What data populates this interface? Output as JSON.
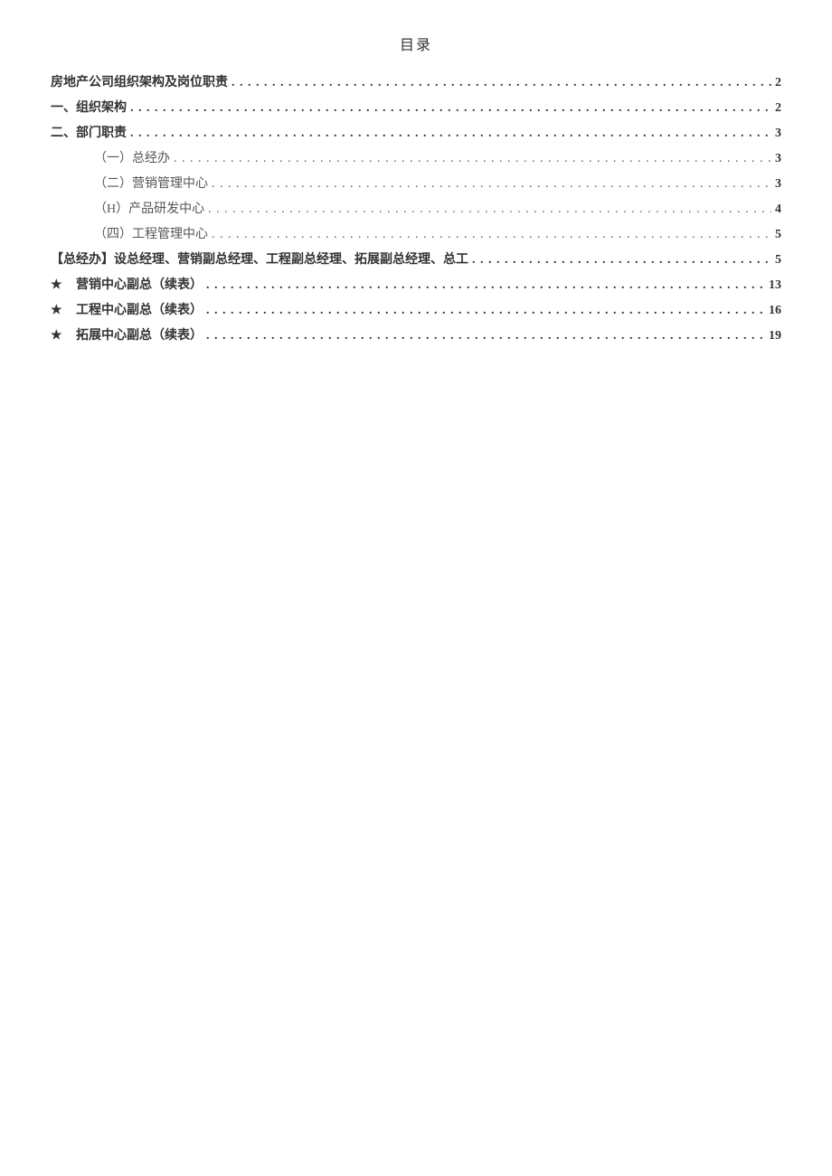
{
  "title": "目录",
  "leader": ". . . . . . . . . . . . . . . . . . . . . . . . . . . . . . . . . . . . . . . . . . . . . . . . . . . . . . . . . . . . . . . . . . . . . . . . . . . . . . . . . . . . . . . . . . . . . . . . . . . . . . . . . . . . . . . . . . . . . . . . . . . . . . . . . . . . . . . . . . . . . . . . . . . . . . . . . . . . . . . . . . . . . . . . . . . . . . . . . . . . . . . . . . . . . . . . . . . . . . . . . . . . . . . . . . . . . . . . . . . . . . . . . . . . . . . . . . . . . . . . . . . . . . . . . . . . . . . . . . . . . . . . . . . . . . . . . . . . . . . . . . . . . . . . . . . . . . . . . . . . . . . . . . . . . . . . . . . . . . . . . . . . . . . . . . . . . . . . . . . . . . . . . . . . . . . . . . . . . . . . . . . . . . . . . . . . . . . . . . . . . . . .",
  "entries": [
    {
      "level": 1,
      "star": false,
      "label": "房地产公司组织架构及岗位职责",
      "page": "2"
    },
    {
      "level": 1,
      "star": false,
      "label": "一、组织架构",
      "page": "2"
    },
    {
      "level": 1,
      "star": false,
      "label": "二、部门职责",
      "page": "3"
    },
    {
      "level": 2,
      "star": false,
      "label": "（一）总经办",
      "page": "3"
    },
    {
      "level": 2,
      "star": false,
      "label": "（二）营销管理中心",
      "page": "3"
    },
    {
      "level": 2,
      "star": false,
      "label": "（H）产品研发中心",
      "page": "4"
    },
    {
      "level": 2,
      "star": false,
      "label": "（四）工程管理中心",
      "page": "5"
    },
    {
      "level": 1,
      "star": false,
      "label": "【总经办】设总经理、营销副总经理、工程副总经理、拓展副总经理、总工",
      "page": "5"
    },
    {
      "level": 1,
      "star": true,
      "label": "营销中心副总（续表）",
      "page": "13"
    },
    {
      "level": 1,
      "star": true,
      "label": "工程中心副总（续表）",
      "page": "16"
    },
    {
      "level": 1,
      "star": true,
      "label": "拓展中心副总（续表）",
      "page": "19"
    }
  ],
  "star_glyph": "★"
}
